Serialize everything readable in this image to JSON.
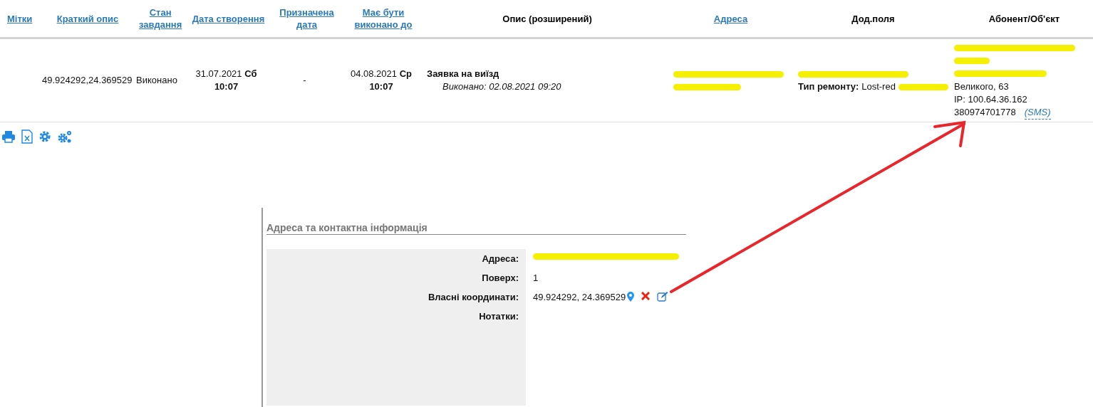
{
  "table": {
    "columns": [
      {
        "label": "Мітки",
        "link": true
      },
      {
        "label": "Краткий опис",
        "link": true
      },
      {
        "label": "Стан завдання",
        "link": true
      },
      {
        "label": "Дата створення",
        "link": true
      },
      {
        "label": "Призначена дата",
        "link": true
      },
      {
        "label": "Має бути виконано до",
        "link": true
      },
      {
        "label": "Опис (розширений)",
        "link": false
      },
      {
        "label": "Адреса",
        "link": true
      },
      {
        "label": "Дод.поля",
        "link": false
      },
      {
        "label": "Абонент/Об'єкт",
        "link": false
      }
    ],
    "rows": [
      {
        "short": "49.924292,24.369529",
        "status": "Виконано",
        "created": {
          "date": "31.07.2021",
          "weekday": "Сб",
          "time": "10:07"
        },
        "assigned": "-",
        "due": {
          "date": "04.08.2021",
          "weekday": "Ср",
          "time": "10:07"
        },
        "description": {
          "title": "Заявка на виїзд",
          "note": "Виконано: 02.08.2021 09:20"
        },
        "address": [
          [
            {
              "kind": "redacted"
            }
          ],
          [
            {
              "kind": "redacted"
            }
          ]
        ],
        "extra": [
          [
            {
              "kind": "redacted"
            }
          ],
          [
            {
              "kind": "bold",
              "text": "Тип ремонту:"
            },
            {
              "kind": "text",
              "text": "Lost-red"
            },
            {
              "kind": "redacted"
            }
          ]
        ],
        "subscriber": [
          [
            {
              "kind": "redacted"
            }
          ],
          [
            {
              "kind": "redacted"
            }
          ],
          [
            {
              "kind": "redacted"
            }
          ],
          [
            {
              "kind": "text",
              "text": "Великого, 63"
            }
          ],
          [
            {
              "kind": "text",
              "text": "IP: 100.64.36.162"
            }
          ],
          [
            {
              "kind": "text",
              "text": "380974701778"
            },
            {
              "kind": "link",
              "text": "(SMS)"
            }
          ]
        ]
      }
    ]
  },
  "panel": {
    "title": "Адреса та контактна інформація",
    "fields": [
      {
        "label": "Адреса:",
        "kind": "redacted"
      },
      {
        "label": "Поверх:",
        "kind": "text",
        "value": "1"
      },
      {
        "label": "Власні координати:",
        "kind": "coords",
        "value": "49.924292, 24.369529"
      },
      {
        "label": "Нотатки:",
        "kind": "empty"
      }
    ]
  }
}
